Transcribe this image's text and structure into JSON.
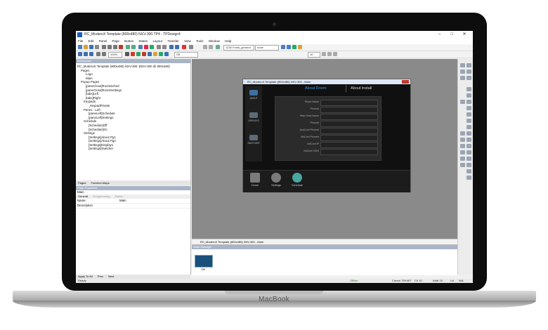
{
  "brand": "MacBook",
  "window": {
    "title": "RC_ModeroX Template (800x480) NXV-300.TP4 - TPDesign4",
    "controls": [
      "–",
      "□",
      "✕"
    ]
  },
  "menu": [
    "File",
    "Edit",
    "Panel",
    "Page",
    "Button",
    "States",
    "Layout",
    "Transfer",
    "View",
    "Tools",
    "Window",
    "Help"
  ],
  "toolbar": {
    "zoom": "100%",
    "state": "Off",
    "font_combo": "1230 Fonts_general",
    "size_combo": "none",
    "font_size": "10"
  },
  "workspace": {
    "header": "Workspace",
    "tree": [
      "RC_ModeroX Template (800x480) NXV-300: [NXV-300 @ 800x480]",
      "Pages",
      "Logo",
      "Main",
      "Popup Pages",
      "[paneClose]RoomSched",
      "[paneClose]RoomSettings",
      "[tabs]Left",
      "[tabs]Right",
      "Keypads",
      "_keypadPrivate",
      "Panes - Left",
      "[paneLeft]Schedule",
      "[paneLeft]Settings",
      "Schedule",
      "[Schedule]Off",
      "[Schedule]On",
      "Settings",
      "[Settings]About Pg1",
      "[Settings]About Pg2",
      "[Settings]Displays",
      "[Settings]Switcher"
    ],
    "tabs": [
      "Pages",
      "Function Maps"
    ]
  },
  "properties": {
    "header": "Page Properties",
    "object": "Main",
    "tabs": [
      "General",
      "Programming",
      "States"
    ],
    "rows": [
      {
        "key": "Name",
        "value": "Main"
      },
      {
        "key": "Description",
        "value": ""
      }
    ],
    "bottom_tabs": [
      "Apply To All",
      "Prev",
      "Next"
    ]
  },
  "design": {
    "header": "RC_ModeroX Template (800x480) NXV-300 - Main",
    "tabs": [
      "About Room",
      "About Install"
    ],
    "active_tab": "About Room",
    "side_nav": [
      "ABOUT",
      "DISPLAYS",
      "SWITCHER"
    ],
    "fields": [
      "Room Name",
      "Phone#",
      "Help Desk Name",
      "Phone#",
      "AudConf Phone#",
      "VidConf Phone#",
      "VidConf IP",
      "VidConf ISDN"
    ],
    "footer_buttons": [
      "Home",
      "Settings",
      "Schedule"
    ],
    "page_tab": "RC_ModeroX Template (800x480) NXV-300 - Main"
  },
  "state_manager": {
    "header": "State Manager",
    "thumb_label": "Off"
  },
  "statusbar": {
    "left": "Ready",
    "connection": "Offline",
    "cursor": "Cursor 799:467",
    "ch": "Ch 10",
    "addr": "Addr 10",
    "lvl": "Lvl",
    "na": "N/A"
  }
}
